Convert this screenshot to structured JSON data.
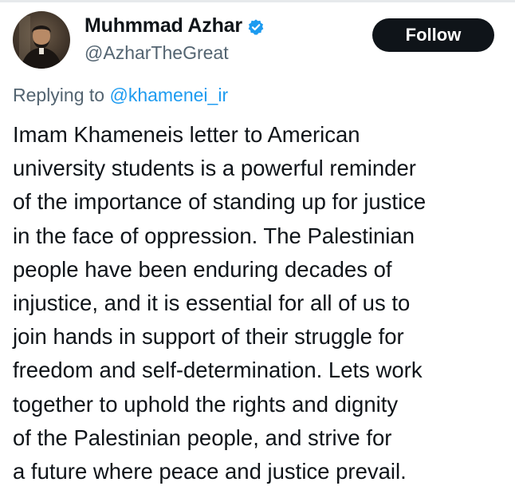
{
  "author": {
    "display_name": "Muhmmad Azhar",
    "handle": "@AzharTheGreat",
    "verified": true,
    "avatar_icon": "profile-photo"
  },
  "follow_button": {
    "label": "Follow"
  },
  "reply": {
    "prefix": "Replying to",
    "mention": "@khamenei_ir"
  },
  "tweet": {
    "lines": [
      "Imam Khameneis letter to American",
      "university students is a powerful reminder",
      "of the importance of standing up for justice",
      "in the face of oppression. The Palestinian",
      "people have been enduring decades of",
      "injustice, and it is essential for all of us to",
      "join hands in support of their struggle for",
      "freedom and self-determination. Lets work",
      "together to uphold the rights and dignity",
      "of the Palestinian people, and strive for",
      "a future where peace and justice prevail."
    ]
  },
  "colors": {
    "text": "#0f1419",
    "secondary": "#536471",
    "accent": "#1d9bf0",
    "button_bg": "#0f1419",
    "button_text": "#ffffff"
  }
}
